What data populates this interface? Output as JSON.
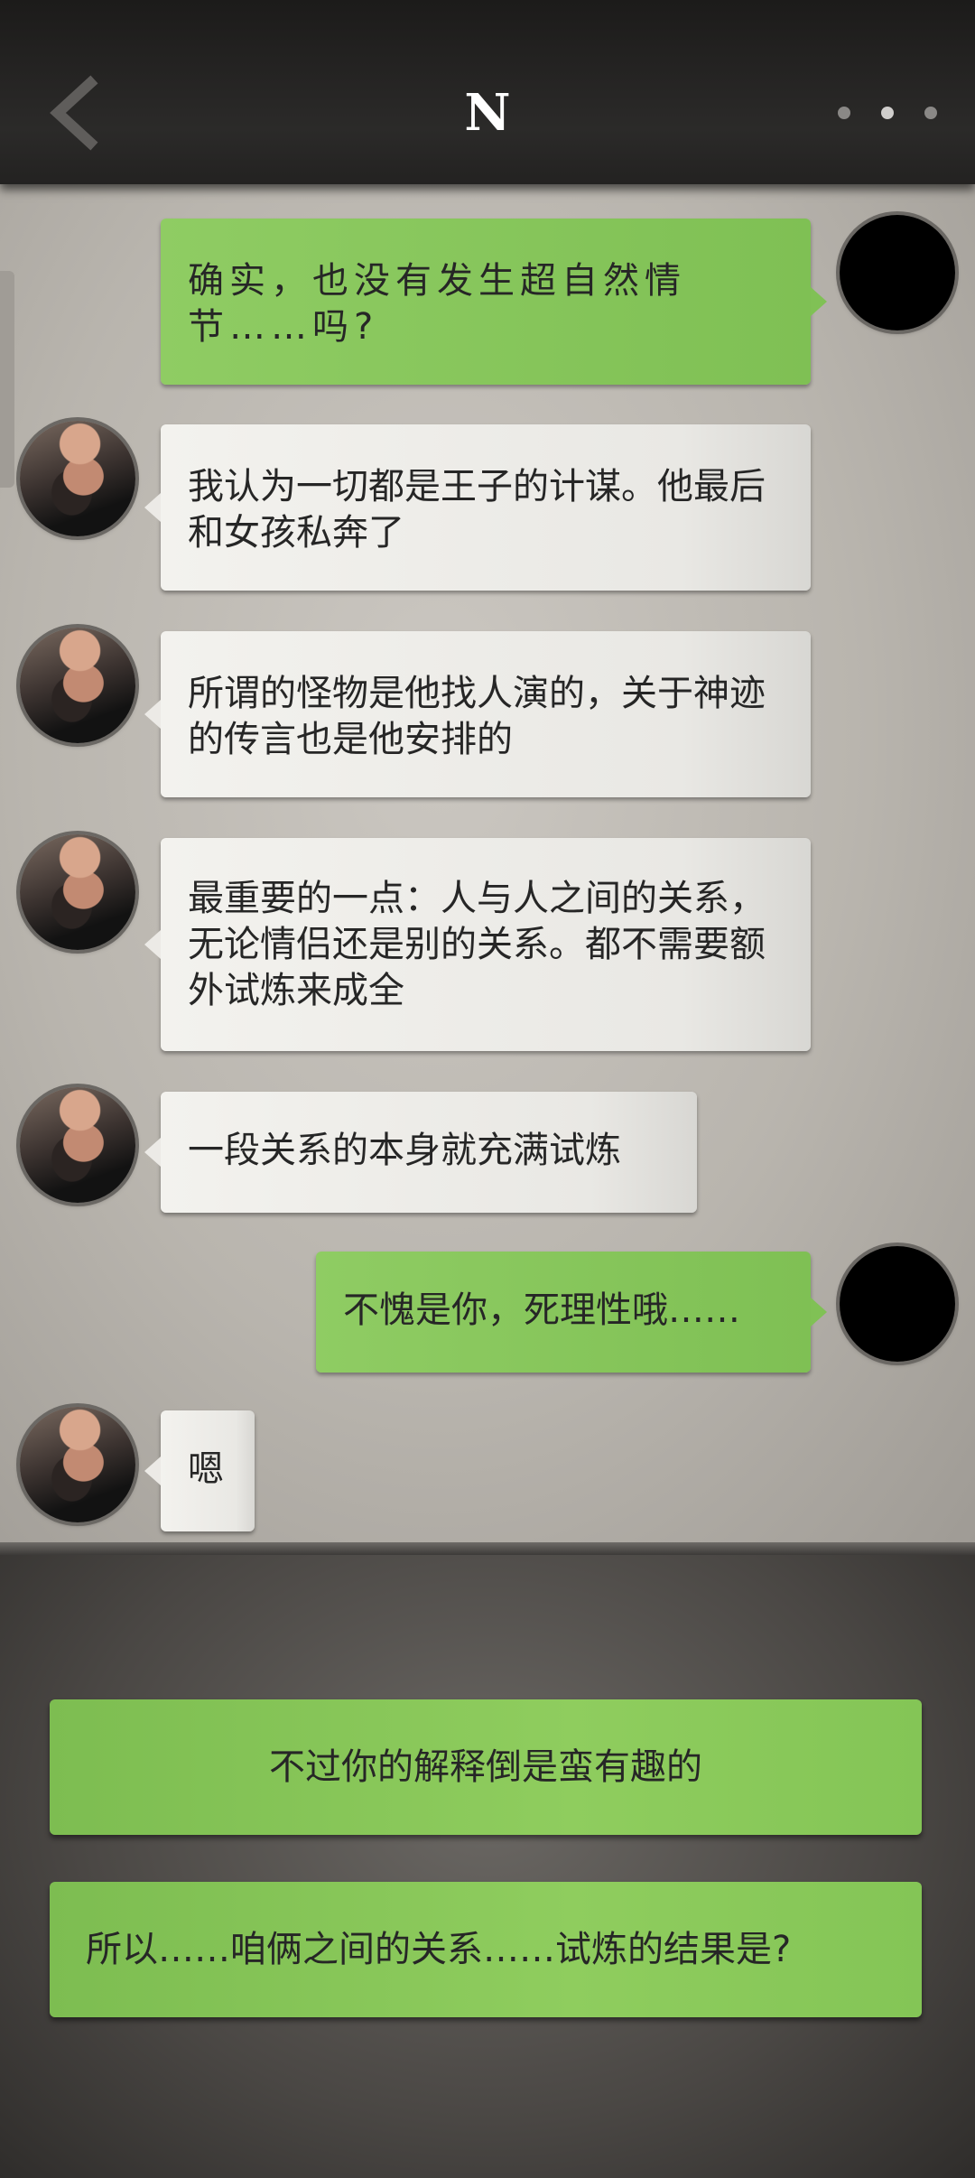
{
  "header": {
    "title": "N",
    "back_icon": "chevron-left-icon",
    "more_icon": "more-dots-icon"
  },
  "messages": [
    {
      "sender": "me",
      "text": "确实，也没有发生超自然情节……吗?"
    },
    {
      "sender": "other",
      "text": "我认为一切都是王子的计谋。他最后和女孩私奔了"
    },
    {
      "sender": "other",
      "text": "所谓的怪物是他找人演的，关于神迹的传言也是他安排的"
    },
    {
      "sender": "other",
      "text": "最重要的一点：人与人之间的关系，无论情侣还是别的关系。都不需要额外试炼来成全"
    },
    {
      "sender": "other",
      "text": "一段关系的本身就充满试炼"
    },
    {
      "sender": "me",
      "text": "不愧是你，死理性哦……"
    },
    {
      "sender": "other",
      "text": "嗯"
    }
  ],
  "options": [
    {
      "label": "不过你的解释倒是蛮有趣的"
    },
    {
      "label": "所以……咱俩之间的关系……试炼的结果是?"
    }
  ],
  "colors": {
    "my_bubble": "#86c55a",
    "other_bubble": "#eceae6",
    "option_button": "#88c658",
    "header_bg": "#242322"
  }
}
